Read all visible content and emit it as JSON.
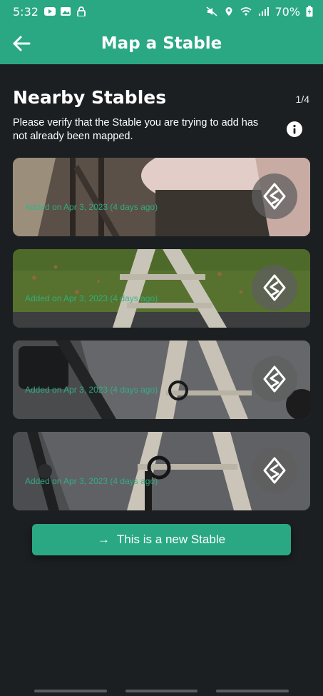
{
  "status_bar": {
    "time": "5:32",
    "battery": "70%"
  },
  "app_bar": {
    "title": "Map a Stable"
  },
  "section": {
    "title": "Nearby Stables",
    "page_count": "1/4",
    "description": "Please verify that the Stable you are trying to add has not already been mapped."
  },
  "stables": [
    {
      "added": "Added on Apr 3, 2023 (4 days ago)"
    },
    {
      "added": "Added on Apr 3, 2023 (4 days ago)"
    },
    {
      "added": "Added on Apr 3, 2023 (4 days ago)"
    },
    {
      "added": "Added on Apr 3, 2023 (4 days ago)"
    }
  ],
  "new_stable_button": {
    "arrow": "→",
    "label": "This is a new Stable"
  },
  "colors": {
    "accent": "#2aa883",
    "background": "#1c1f22"
  }
}
